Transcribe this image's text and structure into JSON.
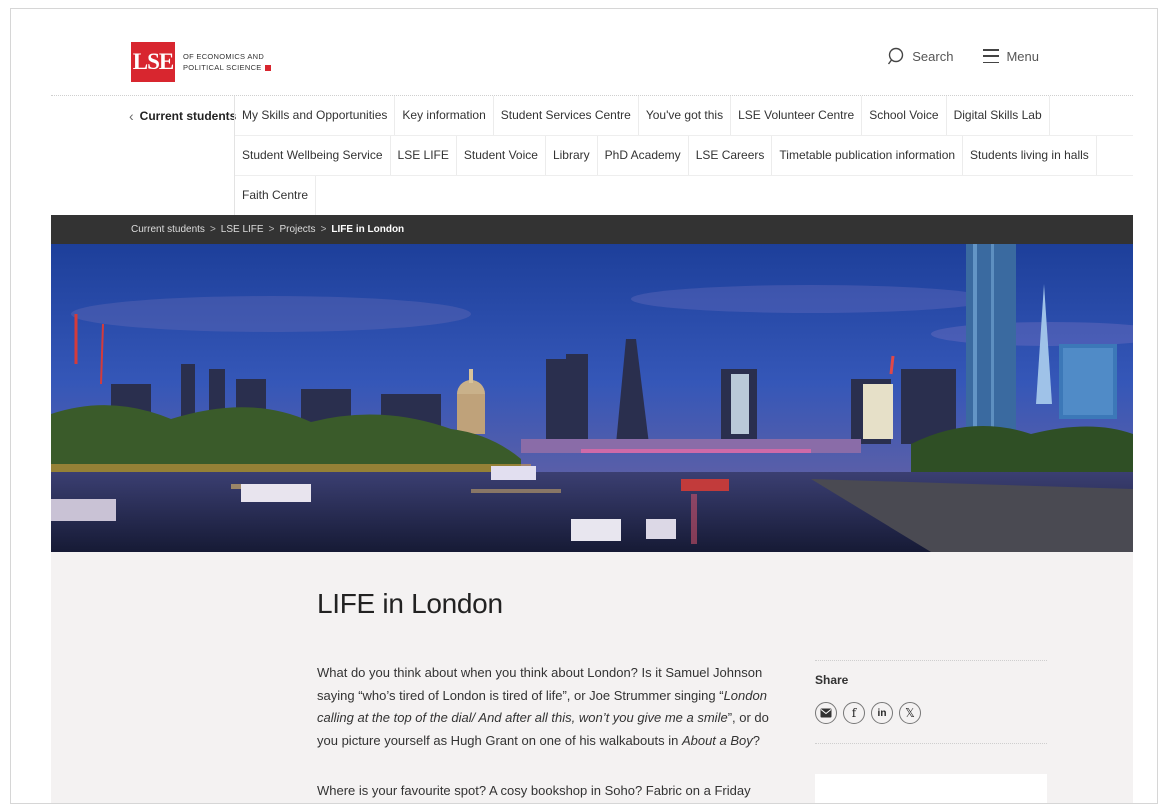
{
  "header": {
    "logo_mark": "LSE",
    "logo_line1": "OF ECONOMICS AND",
    "logo_line2": "POLITICAL SCIENCE",
    "search_label": "Search",
    "menu_label": "Menu"
  },
  "nav": {
    "back_label": "Current students",
    "rows": [
      [
        "My Skills and Opportunities",
        "Key information",
        "Student Services Centre",
        "You've got this",
        "LSE Volunteer Centre",
        "School Voice",
        "Digital Skills Lab"
      ],
      [
        "Student Wellbeing Service",
        "LSE LIFE",
        "Student Voice",
        "Library",
        "PhD Academy",
        "LSE Careers",
        "Timetable publication information",
        "Students living in halls"
      ],
      [
        "Faith Centre"
      ]
    ]
  },
  "breadcrumb": {
    "items": [
      "Current students",
      "LSE LIFE",
      "Projects"
    ],
    "current": "LIFE in London",
    "separator": ">"
  },
  "content": {
    "title": "LIFE in London",
    "para1_a": "What do you think about when you think about London? Is it Samuel Johnson saying “who’s tired of London is tired of life”, or Joe Strummer singing “",
    "para1_italic1": "London calling at the top of the dial/ And after all this, won’t you give me a smile",
    "para1_b": "”, or do you picture yourself as Hugh Grant on one of his walkabouts in ",
    "para1_italic2": "About a Boy",
    "para1_c": "?",
    "para2": "Where is your favourite spot? A cosy bookshop in Soho? Fabric on a Friday night? Or",
    "share_label": "Share",
    "share_icons": [
      "email-icon",
      "facebook-icon",
      "linkedin-icon",
      "x-icon"
    ]
  },
  "colors": {
    "brand_red": "#d8262f",
    "breadcrumb_bg": "#333333",
    "content_bg": "#f4f2f2"
  }
}
